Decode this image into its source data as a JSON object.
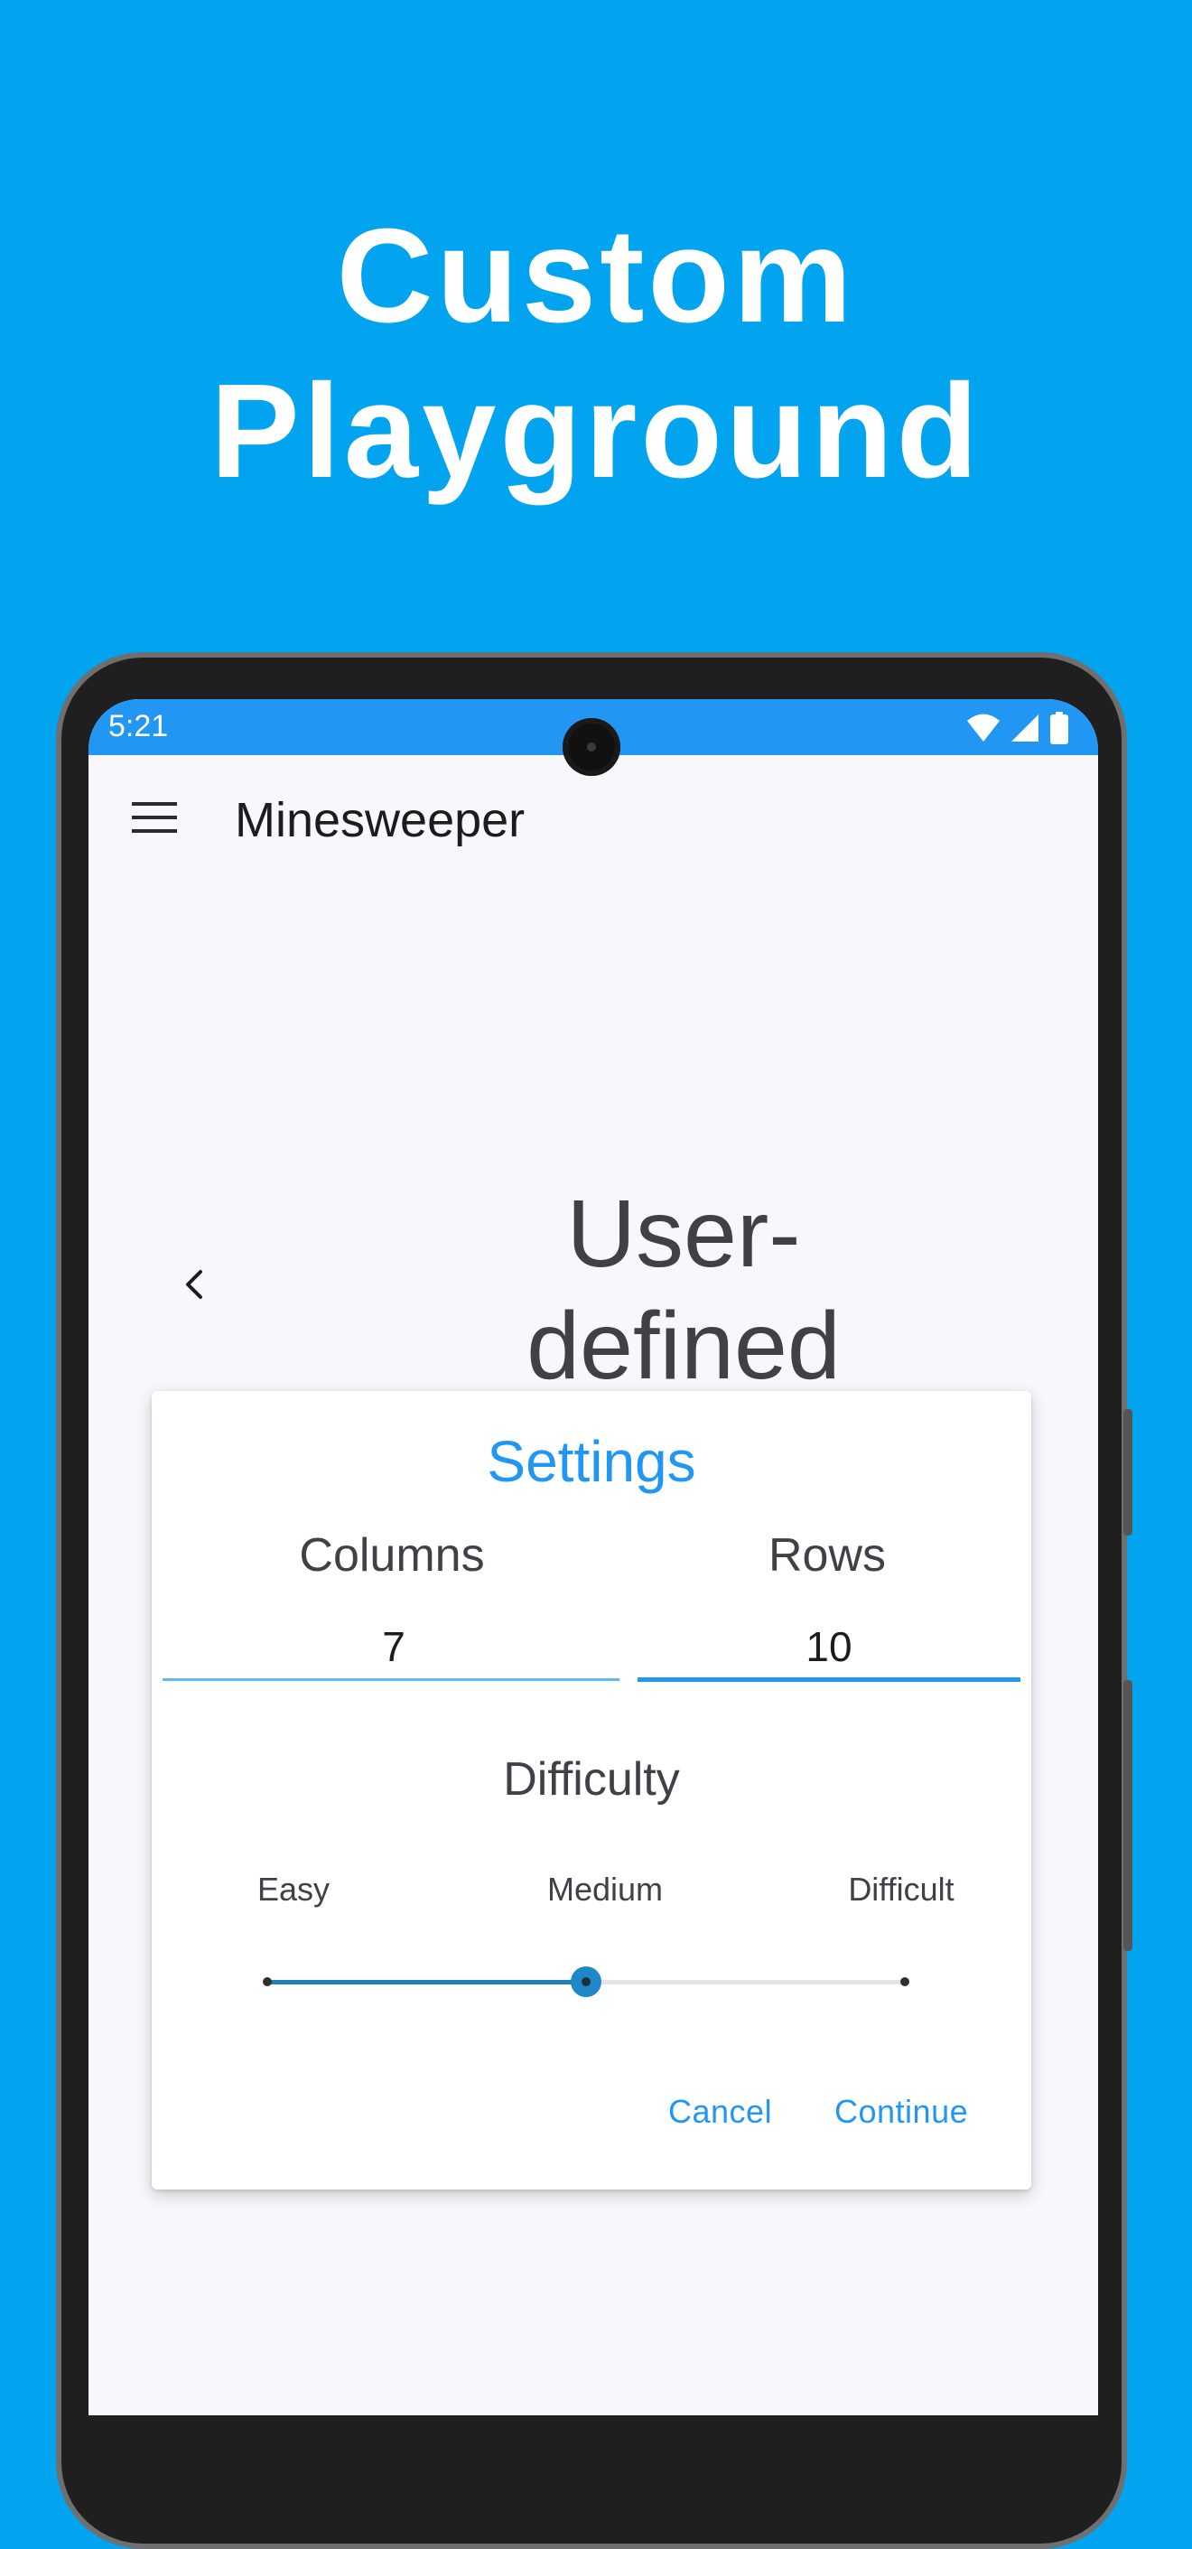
{
  "promo": {
    "line1": "Custom",
    "line2": "Playground"
  },
  "status_bar": {
    "time": "5:21",
    "icons": [
      "wifi-icon",
      "cellular-signal-icon",
      "battery-icon"
    ]
  },
  "app_bar": {
    "menu_icon": "hamburger-menu-icon",
    "title": "Minesweeper"
  },
  "level_carousel": {
    "back_icon": "chevron-left-icon",
    "line1": "User-",
    "line2": "defined"
  },
  "dialog": {
    "title": "Settings",
    "columns": {
      "label": "Columns",
      "value": "7"
    },
    "rows": {
      "label": "Rows",
      "value": "10"
    },
    "difficulty": {
      "label": "Difficulty",
      "options": [
        "Easy",
        "Medium",
        "Difficult"
      ],
      "selected": "Medium",
      "slider_fraction": 0.5
    },
    "cancel_label": "Cancel",
    "continue_label": "Continue"
  },
  "colors": {
    "background": "#03A4EF",
    "accent": "#2196F3",
    "status_bar": "#2196F3",
    "slider_active": "#1F7FB5",
    "text_primary": "#3F4147"
  }
}
